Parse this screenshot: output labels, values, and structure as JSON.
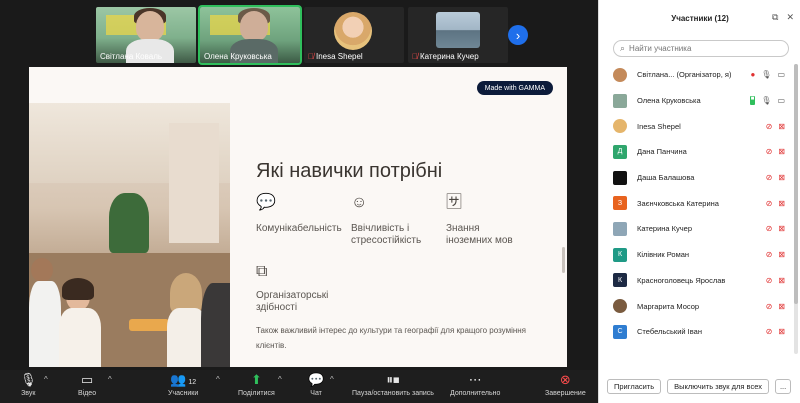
{
  "thumbnails": [
    {
      "name": "Світлана Коваль",
      "muted": false,
      "active": false,
      "style": "video1"
    },
    {
      "name": "Олена Круковська",
      "muted": false,
      "active": true,
      "style": "video2"
    },
    {
      "name": "Inesa Shepel",
      "muted": true,
      "active": false,
      "style": "avatar"
    },
    {
      "name": "Катерина Кучер",
      "muted": true,
      "active": false,
      "style": "city"
    }
  ],
  "slide": {
    "badge": "Made with GAMMA",
    "title": "Які навички потрібні",
    "skills": [
      {
        "label": "Комунікабельність",
        "icon": "chat-bubble-icon"
      },
      {
        "label": "Ввічливість і стресостійкість",
        "icon": "smile-icon"
      },
      {
        "label": "Знання іноземних мов",
        "icon": "translate-icon"
      },
      {
        "label": "Організаторські здібності",
        "icon": "organize-icon"
      }
    ],
    "footer": "Також важливий інтерес до культури та географії для кращого розуміння клієнтів."
  },
  "toolbar": {
    "mic": "Звук",
    "video": "Відео",
    "participants": "Учасники",
    "participants_count": "12",
    "share": "Поділитися",
    "chat": "Чат",
    "record": "Пауза/остановить запись",
    "more": "Дополнительно",
    "end": "Завершение"
  },
  "panel": {
    "title": "Участники (12)",
    "search_placeholder": "Найти участника",
    "participants": [
      {
        "name": "Світлана... (Організатор, я)",
        "avatar": "photo-woman",
        "color": "#c48a5a",
        "initial": "",
        "mic": "on",
        "cam": "on"
      },
      {
        "name": "Олена Круковська",
        "avatar": "photo-room",
        "color": "#8aa899",
        "initial": "",
        "mic": "on",
        "cam": "video"
      },
      {
        "name": "Inesa Shepel",
        "avatar": "photo-blonde",
        "color": "#e5b56b",
        "initial": "",
        "mic": "off",
        "cam": "off"
      },
      {
        "name": "Дана Панчина",
        "avatar": "letter",
        "color": "#2fa66d",
        "initial": "Д",
        "mic": "off",
        "cam": "off"
      },
      {
        "name": "Даша Балашова",
        "avatar": "black",
        "color": "#111111",
        "initial": "",
        "mic": "off",
        "cam": "off"
      },
      {
        "name": "Заєнчковська Катерина",
        "avatar": "letter",
        "color": "#e8631f",
        "initial": "З",
        "mic": "off",
        "cam": "off"
      },
      {
        "name": "Катерина Кучер",
        "avatar": "photo-city",
        "color": "#8ea6b6",
        "initial": "",
        "mic": "off",
        "cam": "off"
      },
      {
        "name": "Кілівник Роман",
        "avatar": "letter",
        "color": "#1f9a86",
        "initial": "К",
        "mic": "off",
        "cam": "off"
      },
      {
        "name": "Красноголовець Ярослав",
        "avatar": "letter",
        "color": "#1d2a44",
        "initial": "К",
        "mic": "off",
        "cam": "off"
      },
      {
        "name": "Маргарита Мосор",
        "avatar": "photo-brown",
        "color": "#7a5b3f",
        "initial": "",
        "mic": "off",
        "cam": "off"
      },
      {
        "name": "Стебельський Іван",
        "avatar": "letter",
        "color": "#2f7dd1",
        "initial": "С",
        "mic": "off",
        "cam": "off"
      }
    ],
    "invite": "Пригласить",
    "mute_all": "Выключить звук для всех",
    "more": "..."
  }
}
